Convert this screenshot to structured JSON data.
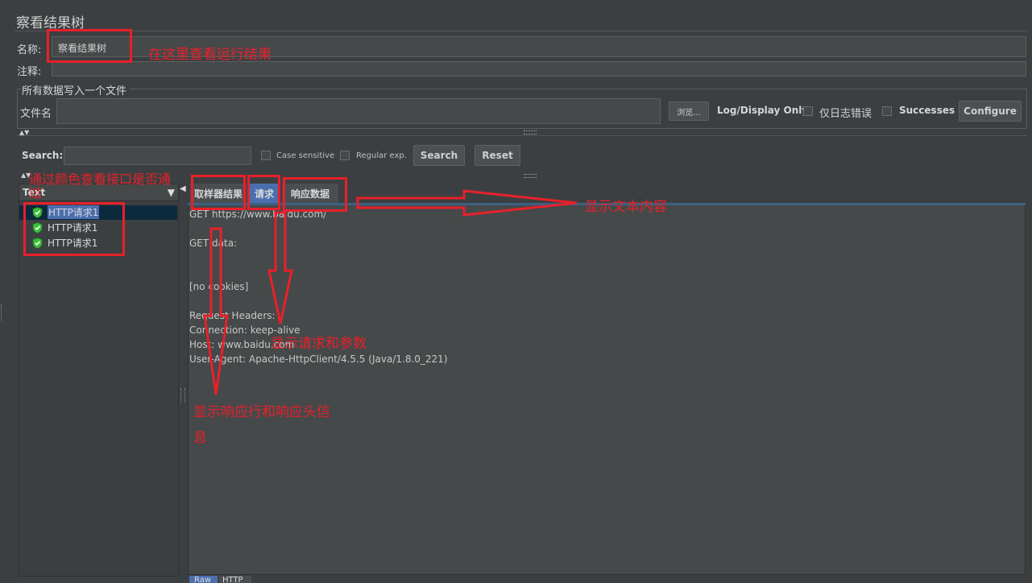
{
  "window": {
    "title": "察看结果树"
  },
  "form": {
    "name_label": "名称:",
    "name_value": "察看结果树",
    "comment_label": "注释:",
    "file_group_title": "所有数据写入一个文件",
    "filename_label": "文件名",
    "browse_label": "浏览...",
    "log_display_label": "Log/Display Only:",
    "errors_only_label": "仅日志错误",
    "successes_label": "Successes",
    "configure_label": "Configure"
  },
  "search": {
    "label": "Search:",
    "case_sensitive": "Case sensitive",
    "regex": "Regular exp.",
    "search_button": "Search",
    "reset_button": "Reset"
  },
  "tree": {
    "renderer_selected": "Text",
    "items": [
      "HTTP请求1",
      "HTTP请求1",
      "HTTP请求1"
    ]
  },
  "tabs": [
    {
      "label": "取样器结果"
    },
    {
      "label": "请求"
    },
    {
      "label": "响应数据"
    }
  ],
  "request_text": [
    "GET https://www.baidu.com/",
    "",
    "GET data:",
    "",
    "",
    "[no cookies]",
    "",
    "Request Headers:",
    "Connection: keep-alive",
    "Host: www.baidu.com",
    "User-Agent: Apache-HttpClient/4.5.5 (Java/1.8.0_221)"
  ],
  "bottom_tabs": [
    "Raw",
    "HTTP"
  ],
  "annotations": {
    "name_note": "在这里查看运行结果",
    "color_note": "通过颜色查看接口是否通过",
    "text_note": "显示文本内容",
    "request_note": "显示请求和参数",
    "response_note_1": "显示响应行和响应头信",
    "response_note_2": "息"
  },
  "colors": {
    "annotation_red": "#e8202a",
    "success_green": "#3cbf3c",
    "selected_row": "#0d293e"
  }
}
